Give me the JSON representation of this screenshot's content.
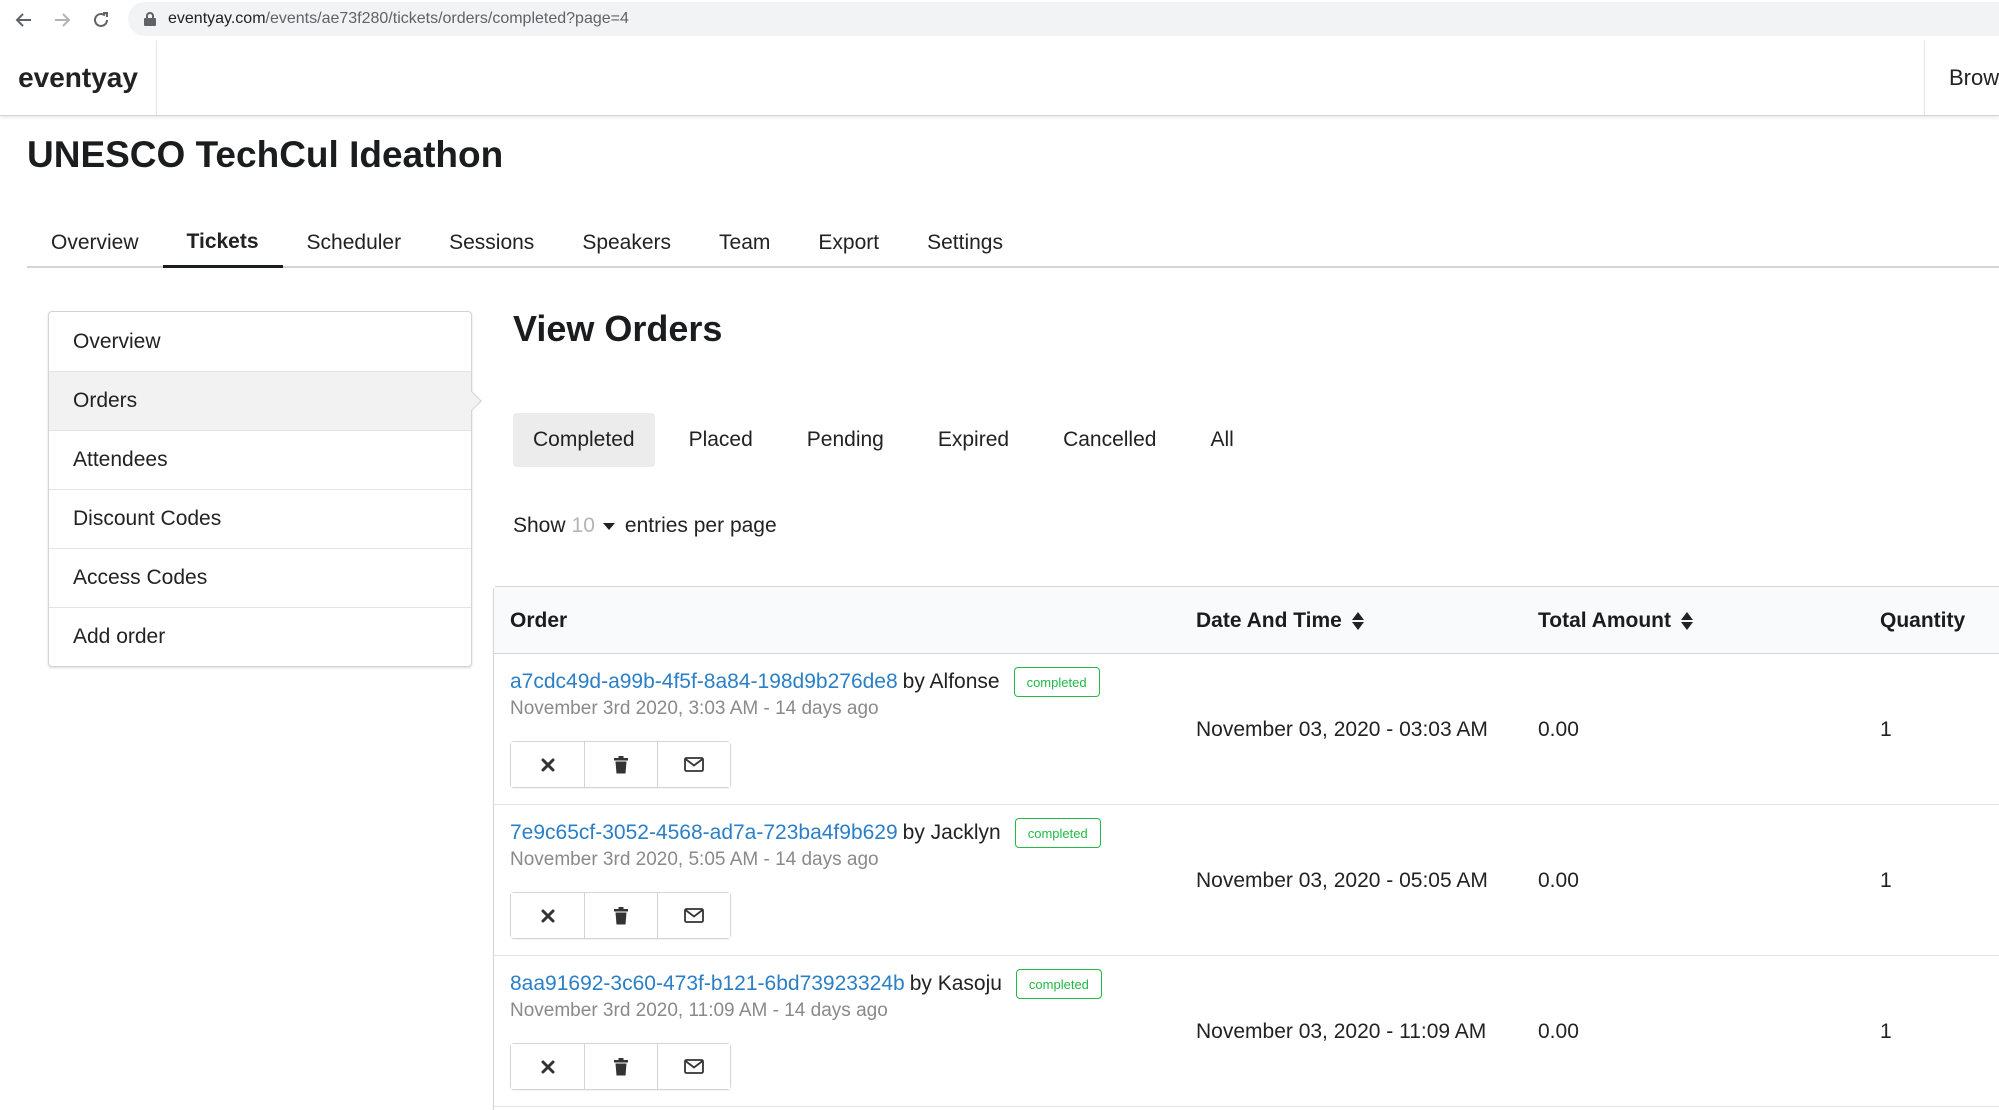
{
  "browser": {
    "url_host": "eventyay.com",
    "url_path": "/events/ae73f280/tickets/orders/completed?page=4",
    "back_icon": "arrow-left-icon",
    "forward_icon": "arrow-right-icon",
    "reload_icon": "reload-icon"
  },
  "header": {
    "brand": "eventyay",
    "browse": "Brow"
  },
  "event": {
    "title": "UNESCO TechCul Ideathon"
  },
  "event_tabs": [
    {
      "label": "Overview"
    },
    {
      "label": "Tickets",
      "active": true
    },
    {
      "label": "Scheduler"
    },
    {
      "label": "Sessions"
    },
    {
      "label": "Speakers"
    },
    {
      "label": "Team"
    },
    {
      "label": "Export"
    },
    {
      "label": "Settings"
    }
  ],
  "sidebar": {
    "items": [
      {
        "label": "Overview"
      },
      {
        "label": "Orders",
        "active": true
      },
      {
        "label": "Attendees"
      },
      {
        "label": "Discount Codes"
      },
      {
        "label": "Access Codes"
      },
      {
        "label": "Add order"
      }
    ]
  },
  "main": {
    "title": "View Orders",
    "status_tabs": [
      {
        "label": "Completed",
        "active": true
      },
      {
        "label": "Placed"
      },
      {
        "label": "Pending"
      },
      {
        "label": "Expired"
      },
      {
        "label": "Cancelled"
      },
      {
        "label": "All"
      }
    ],
    "show_label": "Show",
    "per_page": "10",
    "entries_label": "entries per page"
  },
  "table": {
    "headers": {
      "order": "Order",
      "date": "Date And Time",
      "amount": "Total Amount",
      "quantity": "Quantity"
    },
    "rows": [
      {
        "order_id": "a7cdc49d-a99b-4f5f-8a84-198d9b276de8",
        "by": "by Alfonse",
        "status": "completed",
        "meta": "November 3rd 2020, 3:03 AM - 14 days ago",
        "date": "November 03, 2020 - 03:03 AM",
        "amount": "0.00",
        "quantity": "1"
      },
      {
        "order_id": "7e9c65cf-3052-4568-ad7a-723ba4f9b629",
        "by": "by Jacklyn",
        "status": "completed",
        "meta": "November 3rd 2020, 5:05 AM - 14 days ago",
        "date": "November 03, 2020 - 05:05 AM",
        "amount": "0.00",
        "quantity": "1"
      },
      {
        "order_id": "8aa91692-3c60-473f-b121-6bd73923324b",
        "by": "by Kasoju",
        "status": "completed",
        "meta": "November 3rd 2020, 11:09 AM - 14 days ago",
        "date": "November 03, 2020 - 11:09 AM",
        "amount": "0.00",
        "quantity": "1"
      }
    ],
    "action_icons": [
      "cancel-icon",
      "trash-icon",
      "mail-icon"
    ]
  },
  "colors": {
    "link": "#2a7fc6",
    "badge_green": "#21ba45",
    "active_tab_bg": "#ececec"
  }
}
